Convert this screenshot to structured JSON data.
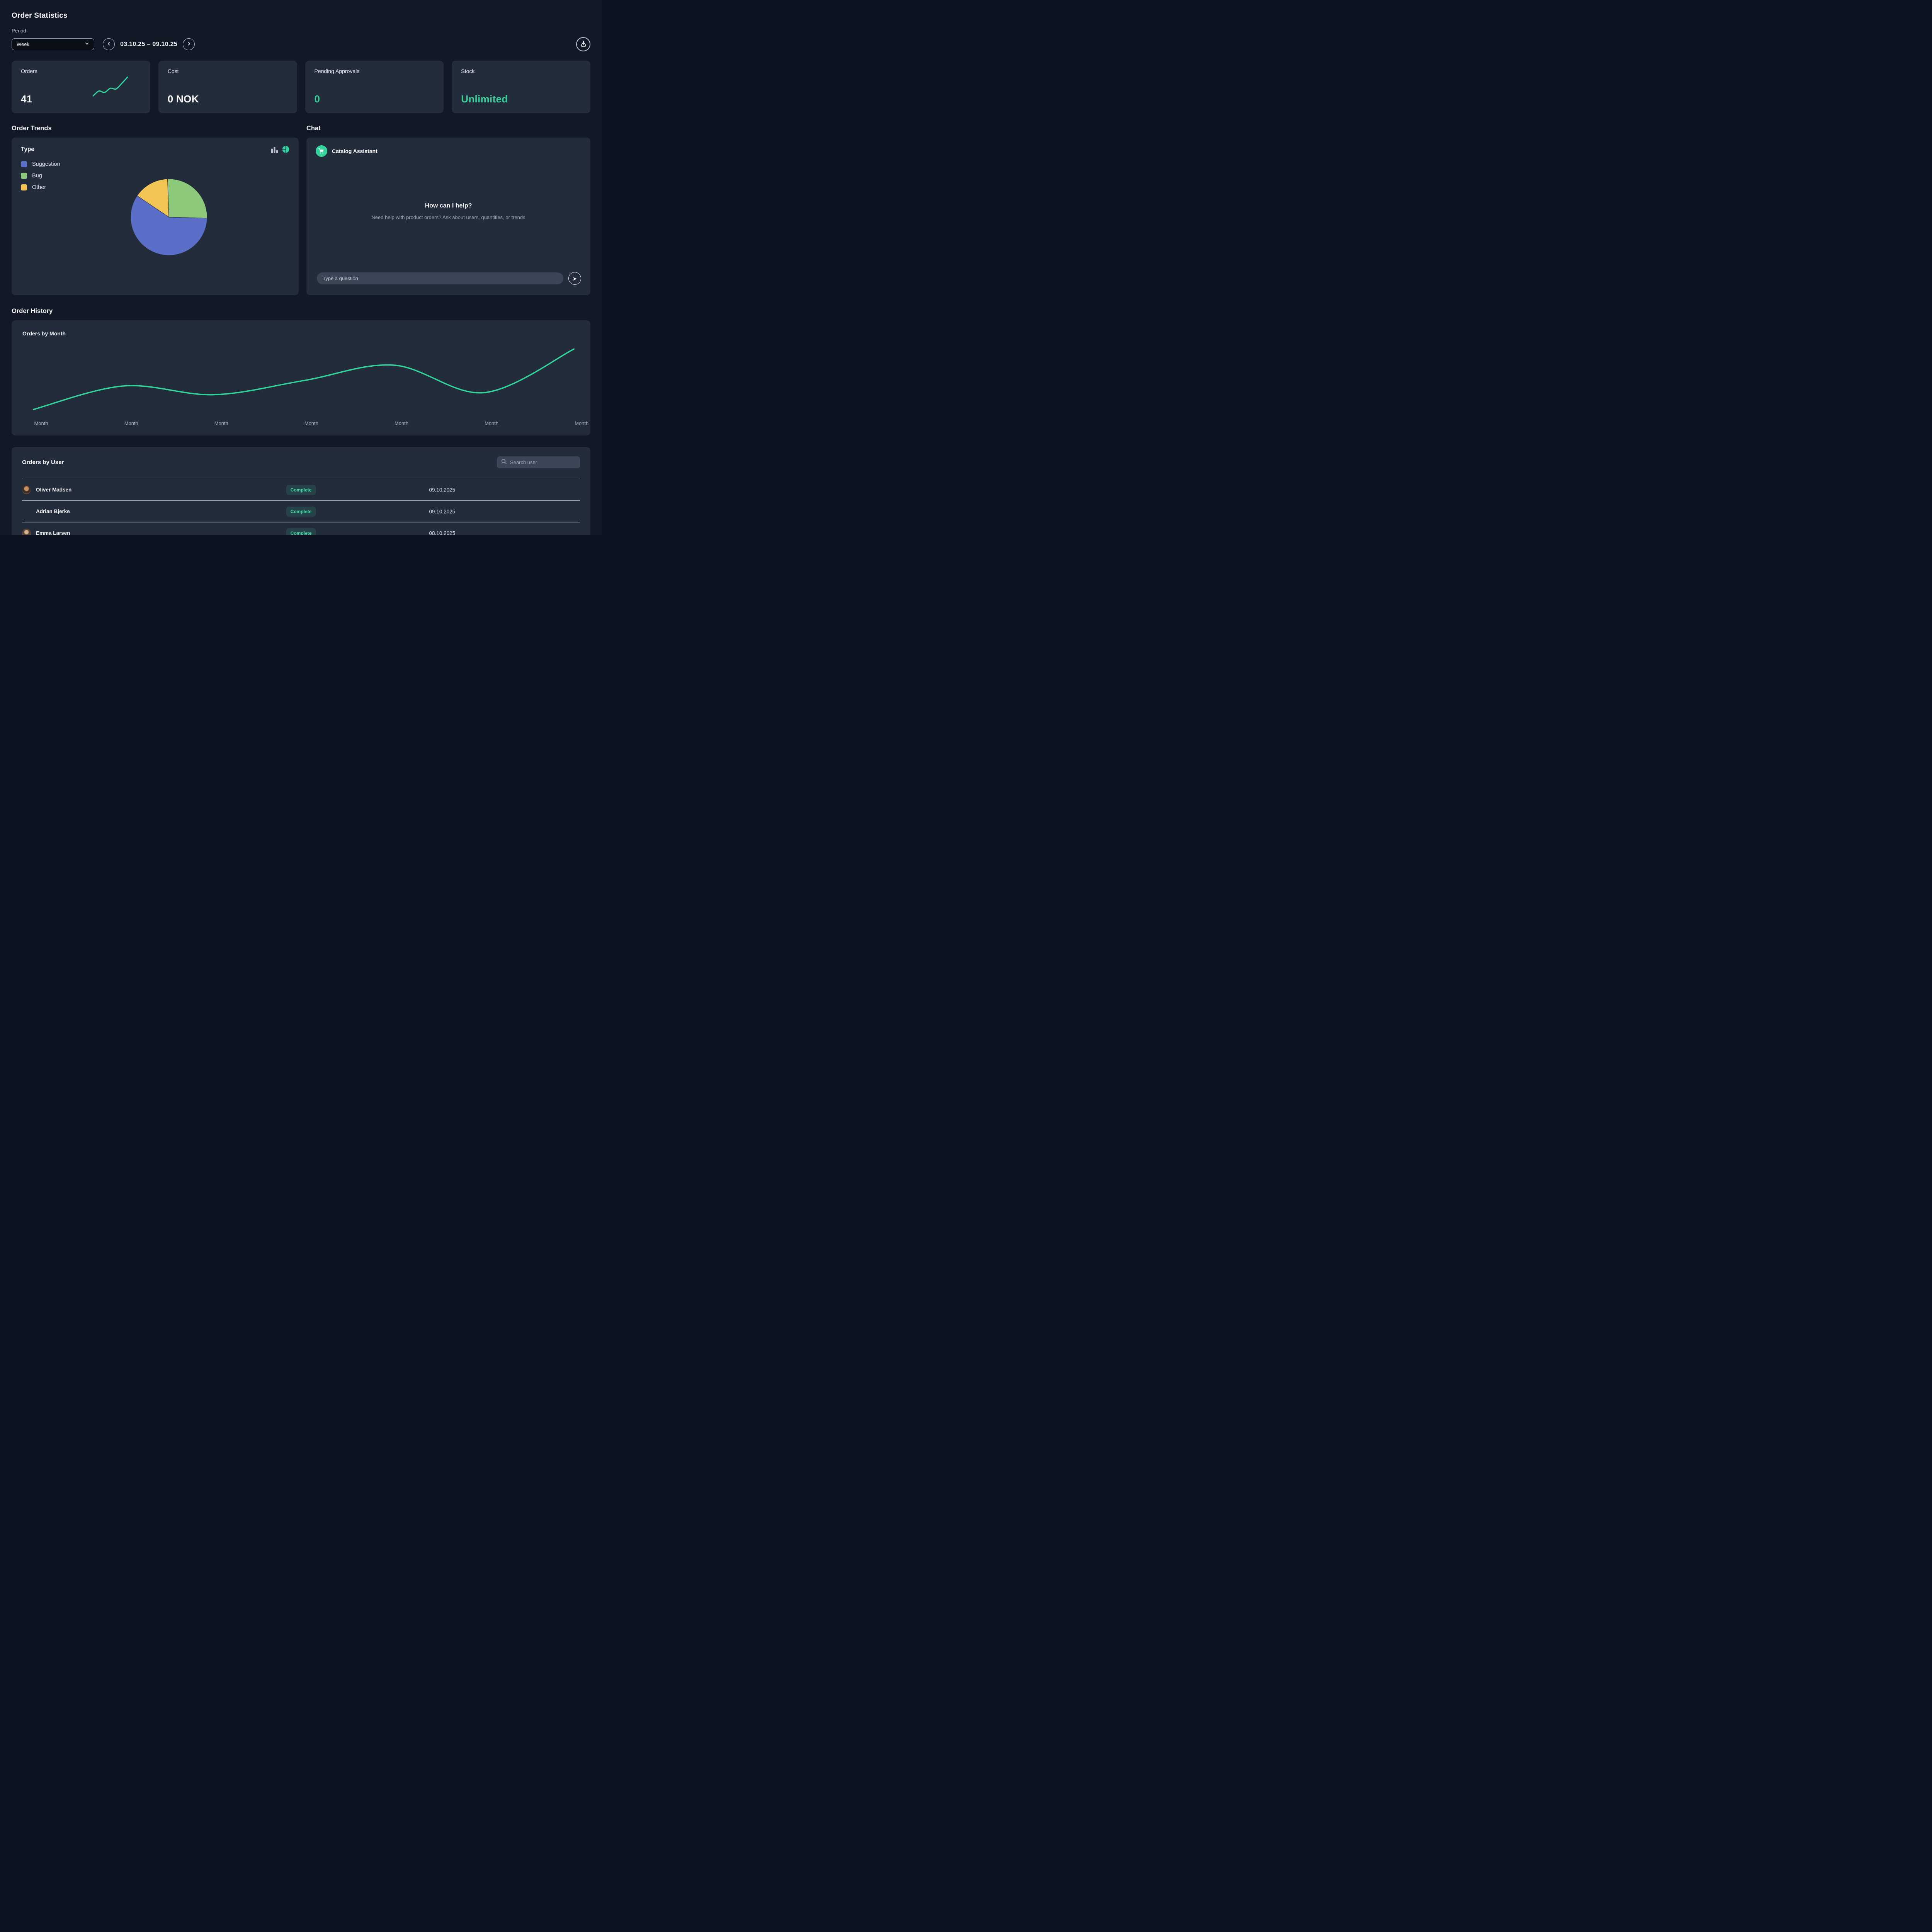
{
  "header": {
    "title": "Order Statistics",
    "period_label": "Period",
    "period_value": "Week",
    "date_range": "03.10.25 – 09.10.25"
  },
  "stats": {
    "orders_label": "Orders",
    "orders_value": "41",
    "cost_label": "Cost",
    "cost_value": "0 NOK",
    "pending_label": "Pending Approvals",
    "pending_value": "0",
    "stock_label": "Stock",
    "stock_value": "Unlimited"
  },
  "sections": {
    "trends": "Order Trends",
    "chat": "Chat",
    "history": "Order History"
  },
  "chat": {
    "assistant_name": "Catalog Assistant",
    "headline": "How can I help?",
    "subtext": "Need help with product orders? Ask about users, quantities, or trends",
    "input_placeholder": "Type a question"
  },
  "users": {
    "card_title": "Orders by User",
    "search_placeholder": "Search user",
    "rows": [
      {
        "name": "Oliver Madsen",
        "status": "Complete",
        "date": "09.10.2025"
      },
      {
        "name": "Adrian Bjerke",
        "status": "Complete",
        "date": "09.10.2025"
      },
      {
        "name": "Emma Larsen",
        "status": "Complete",
        "date": "08.10.2025"
      }
    ]
  },
  "icons": {
    "send_glyph": "➤"
  },
  "colors": {
    "accent": "#34d39b",
    "line": "#30d39a",
    "pie_suggestion": "#5b6fc8",
    "pie_bug": "#8cc97a",
    "pie_other": "#f2c453"
  },
  "chart_data": [
    {
      "type": "pie",
      "title": "Type",
      "slices": [
        {
          "label": "Suggestion",
          "pct": 59,
          "color": "#5b6fc8"
        },
        {
          "label": "Bug",
          "pct": 26,
          "color": "#8cc97a"
        },
        {
          "label": "Other",
          "pct": 15,
          "color": "#f2c453"
        }
      ],
      "start_deg": -2,
      "draw_order": [
        "Bug",
        "Suggestion",
        "Other"
      ],
      "legend_position": "left"
    },
    {
      "type": "line",
      "title": "Orders by Month",
      "x_labels": [
        "Month",
        "Month",
        "Month",
        "Month",
        "Month",
        "Month",
        "Month"
      ],
      "values": [
        5,
        40,
        27,
        48,
        71,
        30,
        95
      ],
      "ylim": [
        0,
        100
      ],
      "grid": false,
      "color": "#30d39a"
    },
    {
      "type": "line",
      "title": "Orders sparkline",
      "values": [
        2,
        16,
        12,
        24,
        22,
        38,
        56
      ],
      "ylim": [
        0,
        60
      ],
      "grid": false,
      "color": "#30d39a"
    }
  ]
}
